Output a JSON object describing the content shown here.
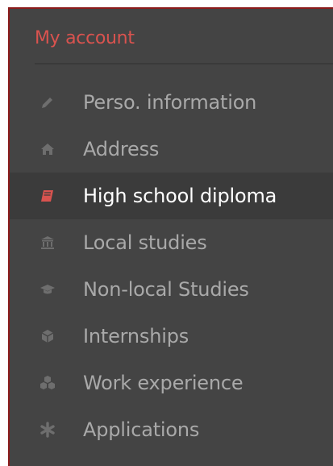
{
  "menu": {
    "title": "My account",
    "items": [
      {
        "label": "Perso. information",
        "icon": "pencil-icon",
        "active": false
      },
      {
        "label": "Address",
        "icon": "home-icon",
        "active": false
      },
      {
        "label": "High school diploma",
        "icon": "book-icon",
        "active": true
      },
      {
        "label": "Local studies",
        "icon": "institution-icon",
        "active": false
      },
      {
        "label": "Non-local Studies",
        "icon": "graduation-cap-icon",
        "active": false
      },
      {
        "label": "Internships",
        "icon": "cube-icon",
        "active": false
      },
      {
        "label": "Work experience",
        "icon": "cubes-icon",
        "active": false
      },
      {
        "label": "Applications",
        "icon": "asterisk-icon",
        "active": false
      }
    ]
  },
  "colors": {
    "accent": "#d9534f",
    "panel_background": "#444444",
    "inactive_text": "#a9a9a9",
    "active_text": "#ffffff"
  }
}
